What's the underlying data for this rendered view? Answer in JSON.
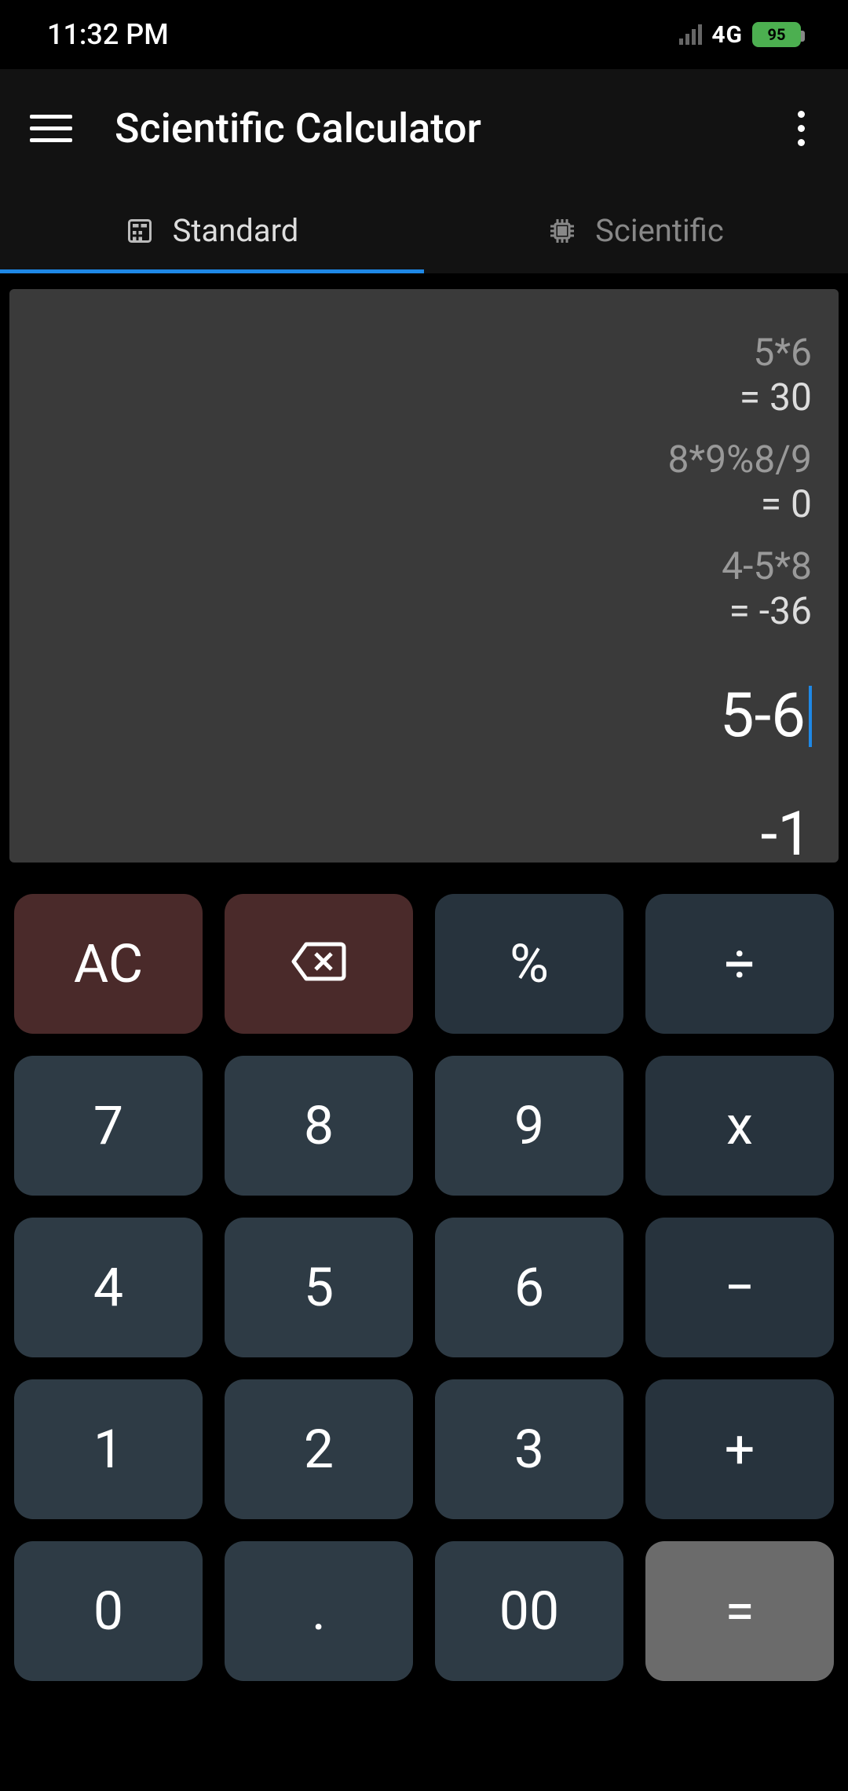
{
  "status": {
    "time": "11:32 PM",
    "network": "4G",
    "battery_pct": "95"
  },
  "header": {
    "title": "Scientific Calculator"
  },
  "tabs": {
    "standard": "Standard",
    "scientific": "Scientific"
  },
  "display": {
    "history": [
      {
        "expr": "5*6",
        "result": "= 30"
      },
      {
        "expr": "8*9%8/9",
        "result": "= 0"
      },
      {
        "expr": "4-5*8",
        "result": "= -36"
      }
    ],
    "current_expr": "5-6",
    "current_result": "-1"
  },
  "keys": {
    "ac": "AC",
    "pct": "%",
    "div": "÷",
    "7": "7",
    "8": "8",
    "9": "9",
    "mul": "x",
    "4": "4",
    "5": "5",
    "6": "6",
    "sub": "−",
    "1": "1",
    "2": "2",
    "3": "3",
    "add": "+",
    "0": "0",
    "dot": ".",
    "00": "00",
    "eq": "="
  }
}
